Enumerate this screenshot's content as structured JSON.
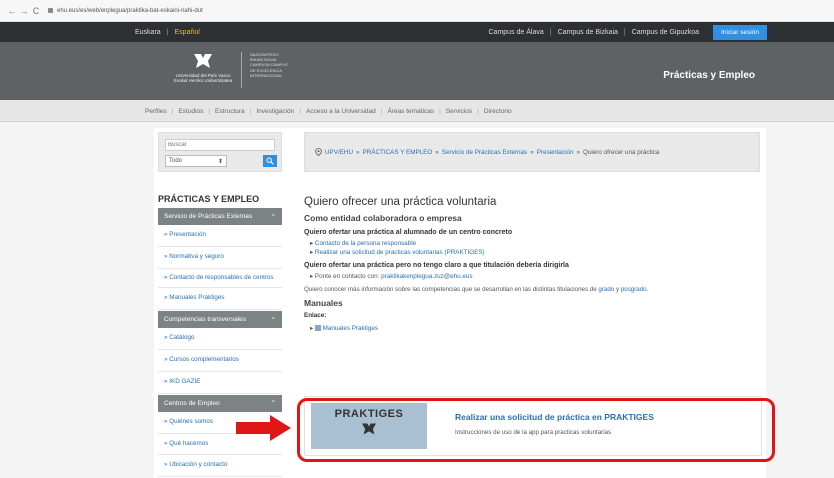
{
  "browser": {
    "url": "ehu.eus/es/web/enplegua/praktika-bat-eskaini-nahi-dut"
  },
  "topbar": {
    "languages": [
      "Euskara",
      "Español"
    ],
    "campuses": [
      "Campus de Álava",
      "Campus de Bizkaia",
      "Campus de Gipuzkoa"
    ],
    "login": "Iniciar sesión"
  },
  "header": {
    "logo_text": "Universidad del País Vasco",
    "logo_text2": "Euskal Herriko Unibertsitatea",
    "campus_text": "NAZIOARTEKO BIKAINTASUN CAMPUSA CAMPUS DE EXCELENCIA INTERNACIONAL",
    "brand": "Prácticas y Empleo"
  },
  "menu": [
    "Perfiles",
    "Estudios",
    "Estructura",
    "Investigación",
    "Acceso a la Universidad",
    "Áreas temáticas",
    "Servicios",
    "Directorio"
  ],
  "search": {
    "placeholder": "Buscar",
    "select": "Todo"
  },
  "breadcrumb": [
    "UPV/EHU",
    "PRÁCTICAS Y EMPLEO",
    "Servicio de Prácticas Externas",
    "Presentación",
    "Quiero ofrecer una práctica"
  ],
  "sidebar": {
    "title": "PRÁCTICAS Y EMPLEO",
    "sections": [
      {
        "label": "Servicio de Prácticas Externas",
        "items": [
          "» Presentación",
          "» Normativa y seguro",
          "» Contacto de responsables de centros",
          "» Manuales Praktiges"
        ]
      },
      {
        "label": "Competencias transversales",
        "items": [
          "» Catálogo",
          "» Cursos complementarios",
          "» IKD GAZIE"
        ]
      },
      {
        "label": "Centros de Empleo",
        "items": [
          "» Quiénes somos",
          "» Qué hacemos",
          "» Ubicación y contacto"
        ]
      }
    ]
  },
  "main": {
    "title": "Quiero ofrecer una práctica voluntaria",
    "subtitle": "Como entidad colaboradora o empresa",
    "q1": "Quiero ofertar una práctica al alumnado de un centro concreto",
    "q1_links": [
      "Contacto de la persona responsable",
      "Realizar una solicitud de practicas voluntarias (PRAKTIGES)"
    ],
    "q2": "Quiero ofertar una práctica pero no tengo claro a que titulación debería dirigirla",
    "q2_text": "Ponte en contacto con:",
    "q2_email": "praktikakenplegua.zuz@ehu.eus",
    "info_pre": "Quiero conocer más información sobre las competencias que se desarrollan en las distintas titulaciones de",
    "info_grado": "grado",
    "info_y": "y",
    "info_posgrado": "posgrado",
    "manuales_title": "Manuales",
    "enlace": "Enlace:",
    "manuales_link": "Manuales Praktiges"
  },
  "card": {
    "img_text": "PRAKTIGES",
    "title": "Realizar una solicitud de práctica en PRAKTIGES",
    "desc": "Instrucciones de uso de la app para practicas voluntarias"
  },
  "colors": {
    "highlight": "#e01616",
    "accent": "#2f8fe0",
    "link": "#2a6fb5"
  }
}
